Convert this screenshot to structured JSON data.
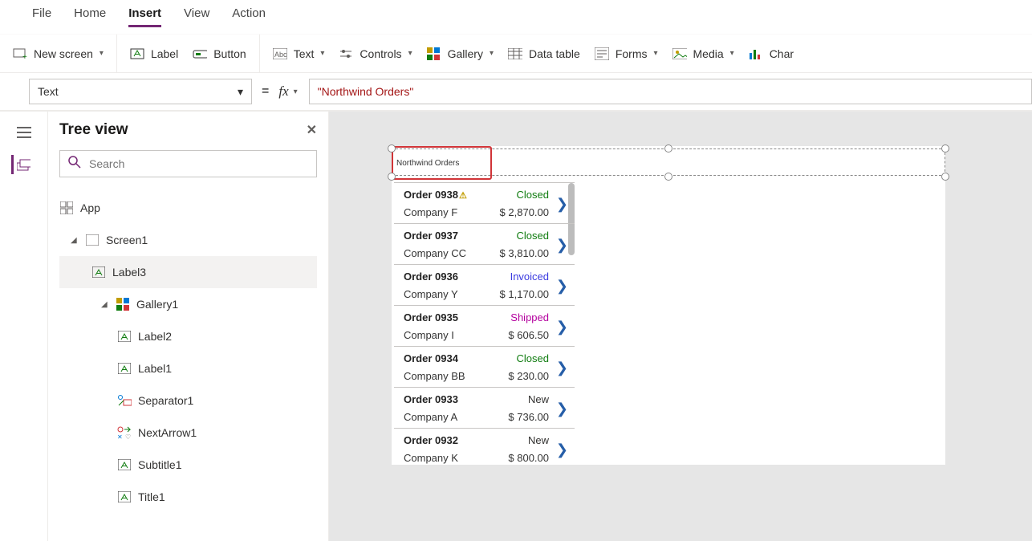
{
  "menu": {
    "file": "File",
    "home": "Home",
    "insert": "Insert",
    "view": "View",
    "action": "Action"
  },
  "ribbon": {
    "newscreen": "New screen",
    "label": "Label",
    "button": "Button",
    "text": "Text",
    "controls": "Controls",
    "gallery": "Gallery",
    "datatable": "Data table",
    "forms": "Forms",
    "media": "Media",
    "charts": "Char"
  },
  "fx": {
    "property": "Text",
    "value": "\"Northwind Orders\""
  },
  "tree": {
    "title": "Tree view",
    "search_ph": "Search",
    "app": "App",
    "screen": "Screen1",
    "label3": "Label3",
    "gallery": "Gallery1",
    "label2": "Label2",
    "label1": "Label1",
    "separator": "Separator1",
    "nextarrow": "NextArrow1",
    "subtitle": "Subtitle1",
    "title1": "Title1"
  },
  "canvas": {
    "label_text": "Northwind Orders",
    "statusColors": {
      "Closed": "#107c10",
      "Invoiced": "#3b3be0",
      "Shipped": "#b4009e",
      "New": "#323130"
    },
    "items": [
      {
        "order": "Order 0938",
        "company": "Company F",
        "status": "Closed",
        "price": "$ 2,870.00",
        "warn": true
      },
      {
        "order": "Order 0937",
        "company": "Company CC",
        "status": "Closed",
        "price": "$ 3,810.00",
        "warn": false
      },
      {
        "order": "Order 0936",
        "company": "Company Y",
        "status": "Invoiced",
        "price": "$ 1,170.00",
        "warn": false
      },
      {
        "order": "Order 0935",
        "company": "Company I",
        "status": "Shipped",
        "price": "$ 606.50",
        "warn": false
      },
      {
        "order": "Order 0934",
        "company": "Company BB",
        "status": "Closed",
        "price": "$ 230.00",
        "warn": false
      },
      {
        "order": "Order 0933",
        "company": "Company A",
        "status": "New",
        "price": "$ 736.00",
        "warn": false
      },
      {
        "order": "Order 0932",
        "company": "Company K",
        "status": "New",
        "price": "$ 800.00",
        "warn": false
      }
    ]
  }
}
